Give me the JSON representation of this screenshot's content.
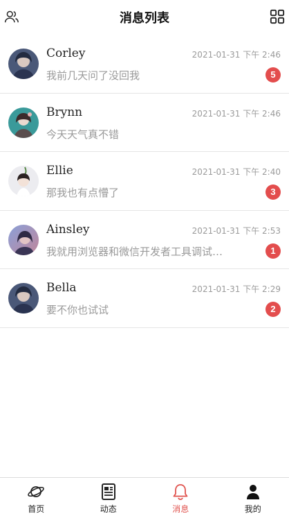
{
  "header": {
    "title": "消息列表",
    "left_icon": "contacts-icon",
    "right_icon": "grid-icon"
  },
  "messages": [
    {
      "name": "Corley",
      "time": "2021-01-31 下午 2:46",
      "preview": "我前几天问了没回我",
      "unread": "5",
      "avatar_color": "#3b4a66"
    },
    {
      "name": "Brynn",
      "time": "2021-01-31 下午 2:46",
      "preview": "今天天气真不错",
      "unread": "",
      "avatar_color": "#2f8a8a"
    },
    {
      "name": "Ellie",
      "time": "2021-01-31 下午 2:40",
      "preview": "那我也有点懵了",
      "unread": "3",
      "avatar_color": "#e6e6ea"
    },
    {
      "name": "Ainsley",
      "time": "2021-01-31 下午 2:53",
      "preview": "我就用浏览器和微信开发者工具调试…",
      "unread": "1",
      "avatar_color": "#6a6ea0"
    },
    {
      "name": "Bella",
      "time": "2021-01-31 下午 2:29",
      "preview": "要不你也试试",
      "unread": "2",
      "avatar_color": "#3b4a66"
    }
  ],
  "tabs": [
    {
      "label": "首页",
      "icon": "planet-icon",
      "active": false
    },
    {
      "label": "动态",
      "icon": "document-icon",
      "active": false
    },
    {
      "label": "消息",
      "icon": "bell-icon",
      "active": true
    },
    {
      "label": "我的",
      "icon": "user-icon",
      "active": false
    }
  ],
  "colors": {
    "accent": "#e0524d",
    "badge": "#e34d4d"
  }
}
